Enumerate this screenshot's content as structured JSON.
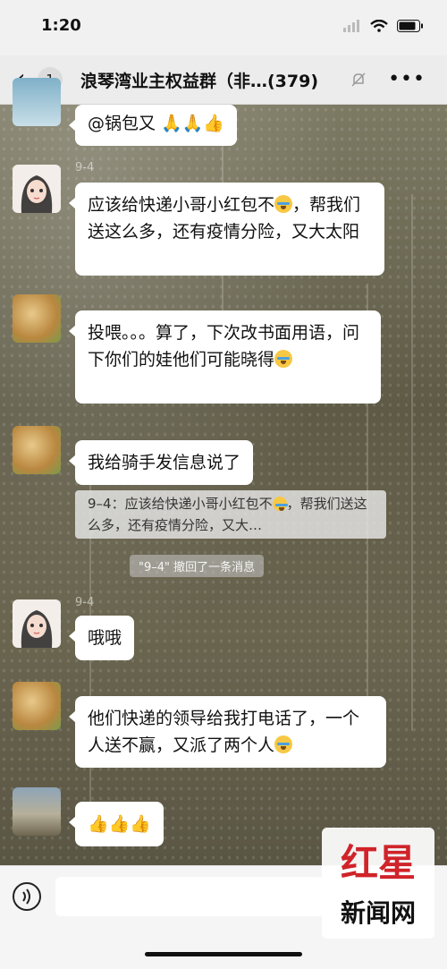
{
  "status": {
    "time": "1:20"
  },
  "nav": {
    "back_count": "1",
    "title": "浪琴湾业主权益群（非…(379)",
    "more": "•••"
  },
  "messages": [
    {
      "nick": "",
      "text": "@锅包又 🙏🙏👍"
    },
    {
      "nick": "9-4",
      "text": "应该给快递小哥小红包不",
      "text2": "，帮我们送这么多，还有疫情分险，又大太阳"
    },
    {
      "nick": "",
      "text": "投喂。。。算了，下次改书面用语，问下你们的娃他们可能晓得"
    },
    {
      "nick": "",
      "text": "我给骑手发信息说了"
    },
    {
      "nick": "9-4",
      "text": "哦哦"
    },
    {
      "nick": "",
      "text": "他们快递的领导给我打电话了，一个人送不赢，又派了两个人"
    },
    {
      "nick": "",
      "text": "👍👍👍"
    }
  ],
  "quote": {
    "text": "9–4：应该给快递小哥小红包不",
    "text2": "，帮我们送这么多，还有疫情分险，又大…"
  },
  "recall": "\"9–4\" 撤回了一条消息",
  "watermark": {
    "top": "红星",
    "bottom": "新闻网"
  }
}
